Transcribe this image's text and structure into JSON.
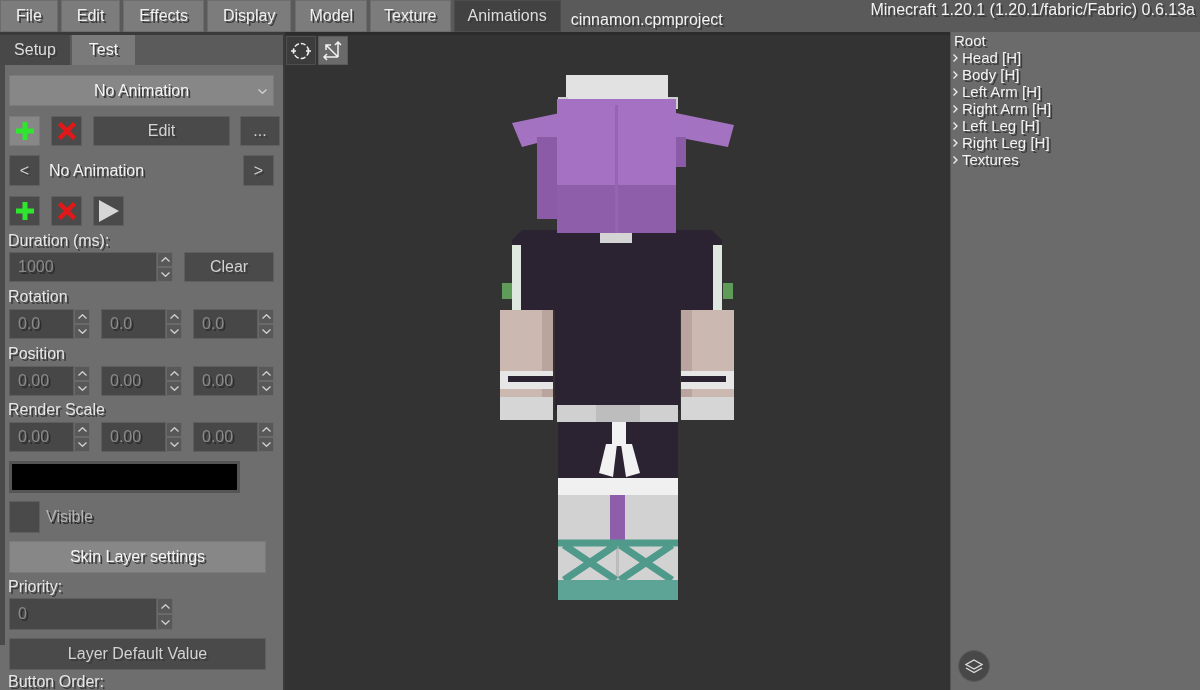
{
  "menu_bar": {
    "menus": [
      "File",
      "Edit",
      "Effects",
      "Display"
    ],
    "tabs": [
      {
        "label": "Model",
        "selected": false
      },
      {
        "label": "Texture",
        "selected": false
      },
      {
        "label": "Animations",
        "selected": true
      }
    ],
    "project_name": "cinnamon.cpmproject",
    "version": "Minecraft 1.20.1 (1.20.1/fabric/Fabric) 0.6.13a"
  },
  "left_panel": {
    "tabs": [
      {
        "label": "Setup",
        "selected": true
      },
      {
        "label": "Test",
        "selected": false
      }
    ],
    "animation_dropdown": {
      "value": "No Animation",
      "disabled": false
    },
    "animation_actions": [
      {
        "kind": "add",
        "disabled": false
      },
      {
        "kind": "delete",
        "disabled": true
      },
      {
        "kind": "text",
        "label": "Edit",
        "disabled": true
      },
      {
        "kind": "text",
        "label": "...",
        "disabled": true
      }
    ],
    "frame_nav": [
      {
        "kind": "button",
        "label": "<",
        "disabled": true
      },
      {
        "kind": "label",
        "label": "No Animation"
      },
      {
        "kind": "button",
        "label": ">",
        "disabled": true
      }
    ],
    "frame_actions": [
      {
        "kind": "add",
        "disabled": true
      },
      {
        "kind": "delete",
        "disabled": true
      },
      {
        "kind": "play",
        "disabled": true
      }
    ],
    "duration": {
      "label": "Duration (ms):",
      "value": "1000",
      "disabled": true,
      "clear_button": "Clear"
    },
    "vectors": [
      {
        "label": "Rotation",
        "fields": [
          {
            "value": "0.0",
            "disabled": true
          },
          {
            "value": "0.0",
            "disabled": true
          },
          {
            "value": "0.0",
            "disabled": true
          }
        ]
      },
      {
        "label": "Position",
        "fields": [
          {
            "value": "0.00",
            "disabled": true
          },
          {
            "value": "0.00",
            "disabled": true
          },
          {
            "value": "0.00",
            "disabled": true
          }
        ]
      },
      {
        "label": "Render Scale",
        "fields": [
          {
            "value": "0.00",
            "disabled": true
          },
          {
            "value": "0.00",
            "disabled": true
          },
          {
            "value": "0.00",
            "disabled": true
          }
        ]
      }
    ],
    "color_swatch": {
      "color": "#000000"
    },
    "visible": {
      "label": "Visible",
      "checked": false,
      "disabled": true
    },
    "skin_layer_button": {
      "label": "Skin Layer settings",
      "disabled": false
    },
    "priority": {
      "label": "Priority:",
      "value": "0",
      "disabled": true
    },
    "layer_default_button": {
      "label": "Layer Default Value",
      "disabled": true
    },
    "button_order": {
      "label": "Button Order:"
    }
  },
  "viewport": {
    "tools": [
      {
        "kind": "rotate",
        "selected": true
      },
      {
        "kind": "move",
        "selected": false
      }
    ]
  },
  "tree": {
    "label": "Root",
    "children": [
      {
        "label": "Head [H]",
        "expanded": false
      },
      {
        "label": "Body [H]",
        "expanded": false
      },
      {
        "label": "Left Arm [H]",
        "expanded": false
      },
      {
        "label": "Right Arm [H]",
        "expanded": false
      },
      {
        "label": "Left Leg [H]",
        "expanded": false
      },
      {
        "label": "Right Leg [H]",
        "expanded": false
      },
      {
        "label": "Textures",
        "expanded": false
      }
    ]
  }
}
